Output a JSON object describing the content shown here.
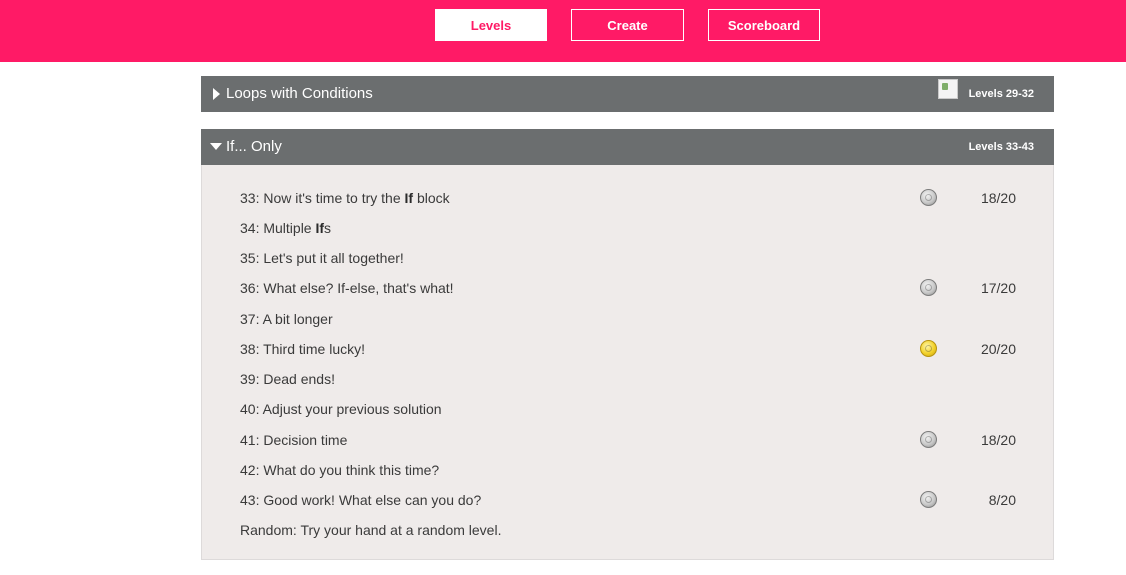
{
  "nav": {
    "levels": "Levels",
    "create": "Create",
    "scoreboard": "Scoreboard"
  },
  "episodes": [
    {
      "title": "Loops with Conditions",
      "levels_range": "Levels 29-32",
      "expanded": false
    },
    {
      "title": "If... Only",
      "levels_range": "Levels 33-43",
      "expanded": true
    }
  ],
  "levels": [
    {
      "prefix": "33: Now it's time to try the ",
      "bold": "If",
      "suffix": " block",
      "medal": "silver-medal-icon",
      "score": "18/20"
    },
    {
      "prefix": "34: Multiple ",
      "bold": "If",
      "suffix": "s",
      "medal": "",
      "score": ""
    },
    {
      "prefix": "35: Let's put it all together!",
      "bold": "",
      "suffix": "",
      "medal": "",
      "score": ""
    },
    {
      "prefix": "36: What else? If-else, that's what!",
      "bold": "",
      "suffix": "",
      "medal": "silver-medal-icon",
      "score": "17/20"
    },
    {
      "prefix": "37: A bit longer",
      "bold": "",
      "suffix": "",
      "medal": "",
      "score": ""
    },
    {
      "prefix": "38: Third time lucky!",
      "bold": "",
      "suffix": "",
      "medal": "gold-medal-icon",
      "score": "20/20"
    },
    {
      "prefix": "39: Dead ends!",
      "bold": "",
      "suffix": "",
      "medal": "",
      "score": ""
    },
    {
      "prefix": "40: Adjust your previous solution",
      "bold": "",
      "suffix": "",
      "medal": "",
      "score": ""
    },
    {
      "prefix": "41: Decision time",
      "bold": "",
      "suffix": "",
      "medal": "silver-medal-icon",
      "score": "18/20"
    },
    {
      "prefix": "42: What do you think this time?",
      "bold": "",
      "suffix": "",
      "medal": "",
      "score": ""
    },
    {
      "prefix": "43: Good work! What else can you do?",
      "bold": "",
      "suffix": "",
      "medal": "silver-medal-icon",
      "score": "8/20"
    },
    {
      "prefix": "Random: Try your hand at a random level.",
      "bold": "",
      "suffix": "",
      "medal": "",
      "score": ""
    }
  ],
  "colors": {
    "brand": "#ff1a66",
    "episode_header": "#6b6e6f",
    "list_background": "#efebea"
  }
}
